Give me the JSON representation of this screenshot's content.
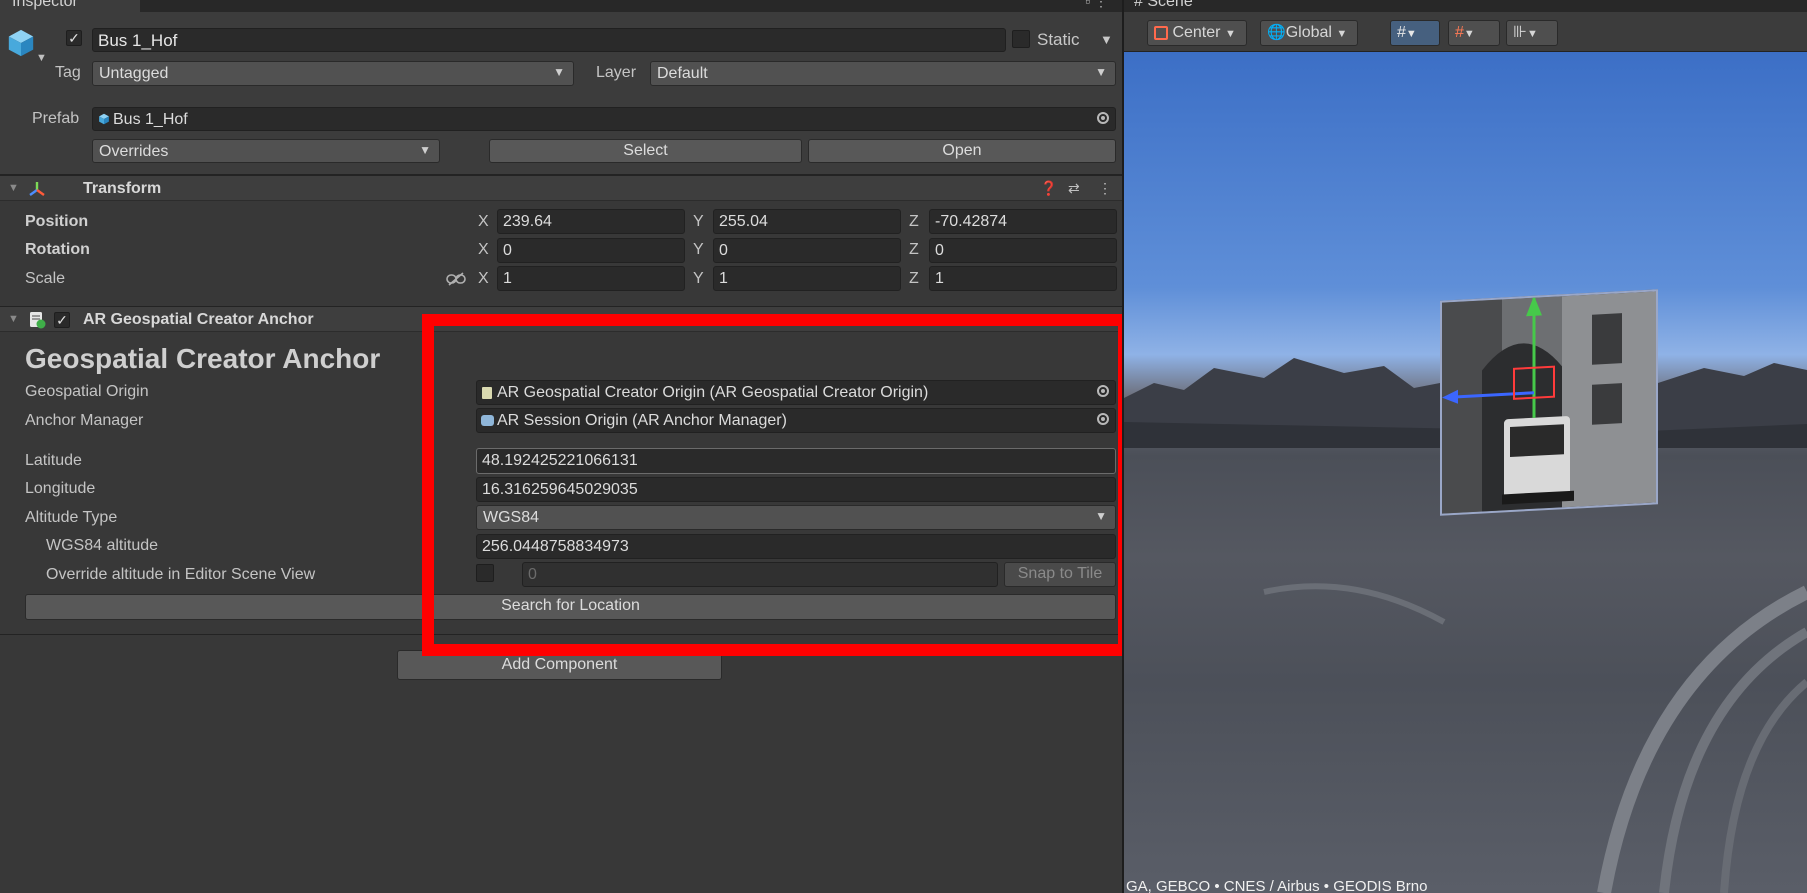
{
  "inspector": {
    "tab_label": "Inspector",
    "tab_buttons": "▫ ⋮",
    "gameobject": {
      "active": true,
      "name": "Bus 1_Hof",
      "static_label": "Static",
      "tag_label": "Tag",
      "tag_value": "Untagged",
      "layer_label": "Layer",
      "layer_value": "Default",
      "prefab_label": "Prefab",
      "prefab_value": "Bus 1_Hof",
      "overrides_label": "Overrides",
      "select_label": "Select",
      "open_label": "Open"
    },
    "transform": {
      "title": "Transform",
      "position_label": "Position",
      "rotation_label": "Rotation",
      "scale_label": "Scale",
      "axis_x": "X",
      "axis_y": "Y",
      "axis_z": "Z",
      "position": {
        "x": "239.64",
        "y": "255.04",
        "z": "-70.42874"
      },
      "rotation": {
        "x": "0",
        "y": "0",
        "z": "0"
      },
      "scale": {
        "x": "1",
        "y": "1",
        "z": "1"
      }
    },
    "anchor": {
      "component_title": "AR Geospatial Creator Anchor",
      "heading": "Geospatial Creator Anchor",
      "geospatial_origin_label": "Geospatial Origin",
      "geospatial_origin_value": "AR Geospatial Creator Origin (AR Geospatial Creator Origin)",
      "anchor_manager_label": "Anchor Manager",
      "anchor_manager_value": "AR Session Origin (AR Anchor Manager)",
      "latitude_label": "Latitude",
      "latitude_value": "48.192425221066131",
      "longitude_label": "Longitude",
      "longitude_value": "16.316259645029035",
      "altitude_type_label": "Altitude Type",
      "altitude_type_value": "WGS84",
      "wgs84_altitude_label": "WGS84 altitude",
      "wgs84_altitude_value": "256.0448758834973",
      "override_label": "Override altitude in Editor Scene View",
      "override_value": "0",
      "snap_label": "Snap to Tile",
      "search_label": "Search for Location"
    },
    "add_component_label": "Add Component"
  },
  "scene": {
    "tab_label": "# Scene",
    "pivot_label": "Center",
    "space_label": "Global",
    "attribution": "GA, GEBCO • CNES / Airbus • GEODIS Brno"
  },
  "colors": {
    "highlight": "#ff0000",
    "panel_bg": "#383838",
    "field_bg": "#2a2a2a"
  }
}
